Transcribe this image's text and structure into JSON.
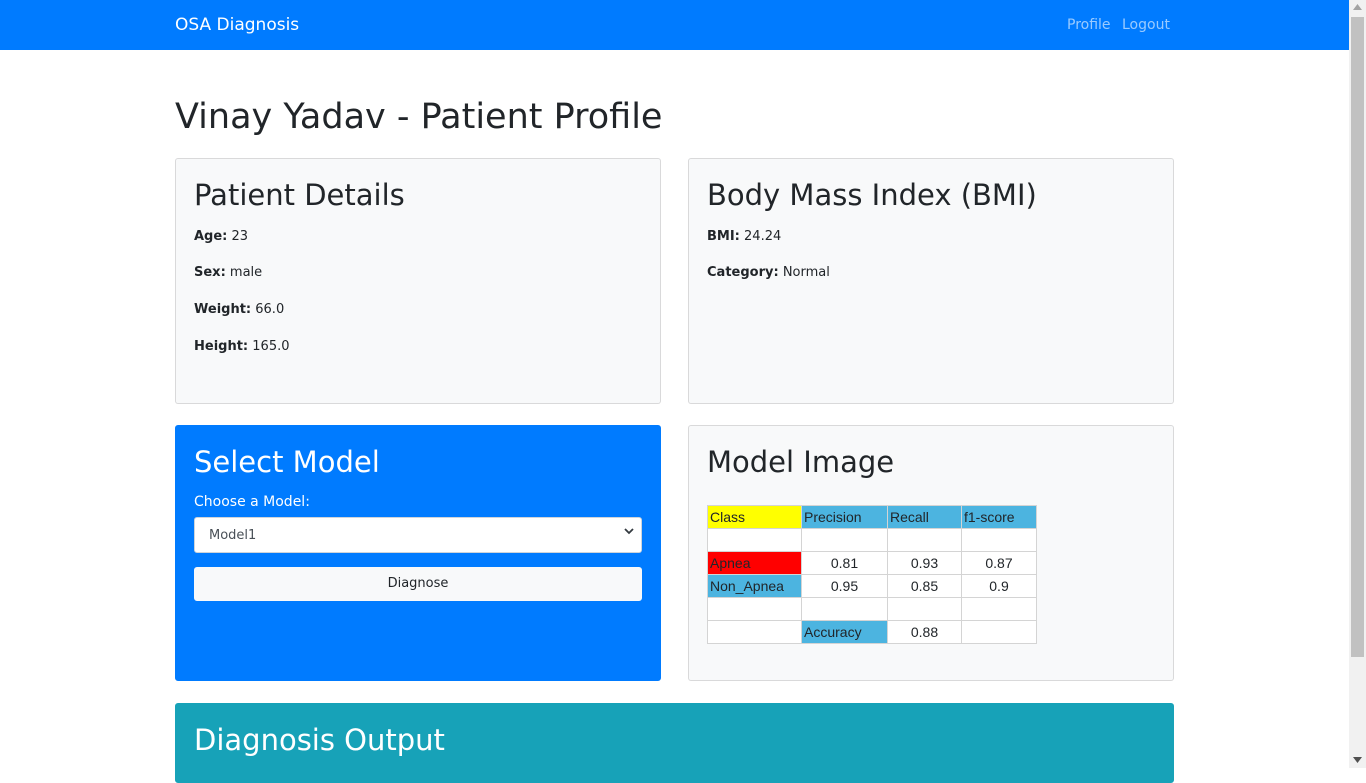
{
  "navbar": {
    "brand": "OSA Diagnosis",
    "links": [
      "Profile",
      "Logout"
    ],
    "bg_color": "#007bff"
  },
  "page_title": "Vinay Yadav - Patient Profile",
  "patient_details": {
    "title": "Patient Details",
    "fields": [
      {
        "label": "Age:",
        "value": "23"
      },
      {
        "label": "Sex:",
        "value": "male"
      },
      {
        "label": "Weight:",
        "value": "66.0"
      },
      {
        "label": "Height:",
        "value": "165.0"
      }
    ]
  },
  "bmi": {
    "title": "Body Mass Index (BMI)",
    "fields": [
      {
        "label": "BMI:",
        "value": "24.24"
      },
      {
        "label": "Category:",
        "value": "Normal"
      }
    ]
  },
  "select_model": {
    "title": "Select Model",
    "label": "Choose a Model:",
    "selected": "Model1",
    "button": "Diagnose",
    "icon": "chevron-down-icon",
    "bg_color": "#007bff"
  },
  "model_image": {
    "title": "Model Image",
    "table": {
      "headers": [
        "Class",
        "Precision",
        "Recall",
        "f1-score"
      ],
      "rows": [
        [
          "",
          "",
          "",
          ""
        ],
        [
          "Apnea",
          "0.81",
          "0.93",
          "0.87"
        ],
        [
          "Non_Apnea",
          "0.95",
          "0.85",
          "0.9"
        ],
        [
          "",
          "",
          "",
          ""
        ],
        [
          "",
          "Accuracy",
          "0.88",
          ""
        ]
      ],
      "colors": {
        "header_class": "#ffff00",
        "header": "#4cb4e0",
        "apnea": "#ff0000",
        "non_apnea": "#4cb4e0"
      }
    }
  },
  "diagnosis_output": {
    "title": "Diagnosis Output",
    "bg_color": "#17a2b8"
  }
}
